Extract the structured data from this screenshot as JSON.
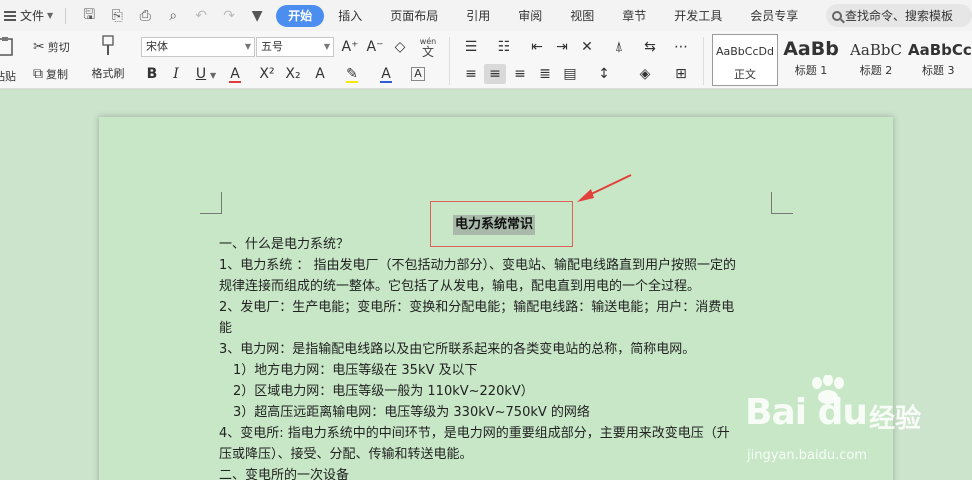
{
  "menubar": {
    "file_label": "文件",
    "tabs": [
      {
        "label": "开始",
        "active": true
      },
      {
        "label": "插入"
      },
      {
        "label": "页面布局"
      },
      {
        "label": "引用"
      },
      {
        "label": "审阅"
      },
      {
        "label": "视图"
      },
      {
        "label": "章节"
      },
      {
        "label": "开发工具"
      },
      {
        "label": "会员专享"
      }
    ],
    "search_text": "查找命令、搜索模板"
  },
  "ribbon": {
    "paste_partial": "粘贴",
    "cut_label": "剪切",
    "copy_label": "复制",
    "format_painter_label": "格式刷",
    "font_name": "宋体",
    "font_size": "五号",
    "wen_label": "wén",
    "styles": [
      {
        "sample": "AaBbCcDd",
        "name": "正文"
      },
      {
        "sample": "AaBb",
        "name": "标题 1"
      },
      {
        "sample": "AaBbC",
        "name": "标题 2"
      },
      {
        "sample": "AaBbCc",
        "name": "标题 3"
      }
    ]
  },
  "document": {
    "title": "电力系统常识",
    "lines": [
      "一、什么是电力系统？",
      "1、电力系统 ：  指由发电厂（不包括动力部分）、变电站、输配电线路直到用户按照一定的",
      "规律连接而组成的统一整体。它包括了从发电，输电，配电直到用电的一个全过程。",
      "2、发电厂：生产电能；变电所：变换和分配电能；输配电线路：输送电能；用户：消费电",
      "能",
      "3、电力网：是指输配电线路以及由它所联系起来的各类变电站的总称，简称电网。",
      "1）地方电力网：电压等级在 35kV 及以下",
      "2）区域电力网：电压等级一般为 110kV~220kV）",
      "3）超高压远距离输电网：电压等级为 330kV~750kV 的网络",
      "4、变电所: 指电力系统中的中间环节，是电力网的重要组成部分，主要用来改变电压（升",
      "压或降压）、接受、分配、传输和转送电能。",
      "二、变电所的一次设备"
    ]
  },
  "watermark": {
    "brand": "Bai du",
    "jingyan": "经验",
    "url": "jingyan.baidu.com"
  }
}
